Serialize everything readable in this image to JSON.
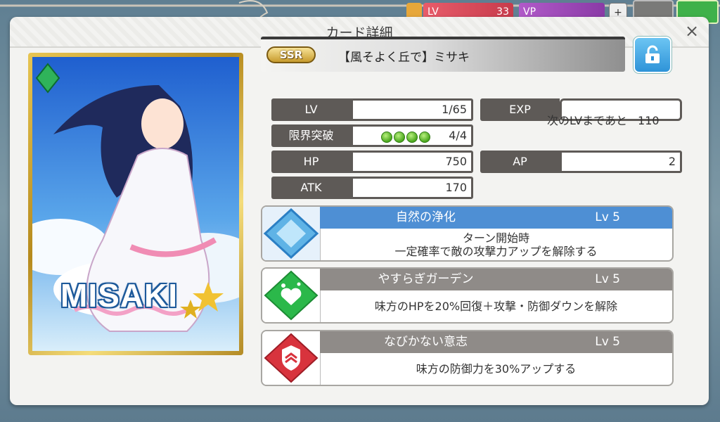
{
  "hud": {
    "lv_label": "LV",
    "lv_value": "33",
    "vp_label": "VP",
    "plus": "+"
  },
  "dialog": {
    "title": "カード詳細",
    "close_glyph": "×"
  },
  "card": {
    "rarity": "SSR",
    "name": "【風そよく丘で】ミサキ",
    "art_name": "MISAKI"
  },
  "stats": {
    "lv": {
      "label": "LV",
      "value": "1/65"
    },
    "exp": {
      "label": "EXP",
      "value": ""
    },
    "limit_break": {
      "label": "限界突破",
      "value": "4/4",
      "pips_filled": 4,
      "pips_total": 4
    },
    "next_lv": {
      "label": "次のLVまであと",
      "value": "110"
    },
    "hp": {
      "label": "HP",
      "value": "750"
    },
    "ap": {
      "label": "AP",
      "value": "2"
    },
    "atk": {
      "label": "ATK",
      "value": "170"
    }
  },
  "skills": [
    {
      "name": "自然の浄化",
      "level": "Lv 5",
      "desc_line1": "ターン開始時",
      "desc_line2": "一定確率で敵の攻撃力アップを解除する",
      "icon": "diamond-icon",
      "color": "#4e8fd4"
    },
    {
      "name": "やすらぎガーデン",
      "level": "Lv 5",
      "desc_line1": "味方のHPを20%回復＋攻撃・防御ダウンを解除",
      "desc_line2": "",
      "icon": "heart-icon",
      "color": "#8f8b88"
    },
    {
      "name": "なびかない意志",
      "level": "Lv 5",
      "desc_line1": "味方の防御力を30%アップする",
      "desc_line2": "",
      "icon": "shield-icon",
      "color": "#8f8b88"
    }
  ],
  "colors": {
    "accent_blue": "#4e8fd4",
    "label_gray": "#5e5a57",
    "green": "#2bb84a",
    "red": "#d8333d"
  }
}
